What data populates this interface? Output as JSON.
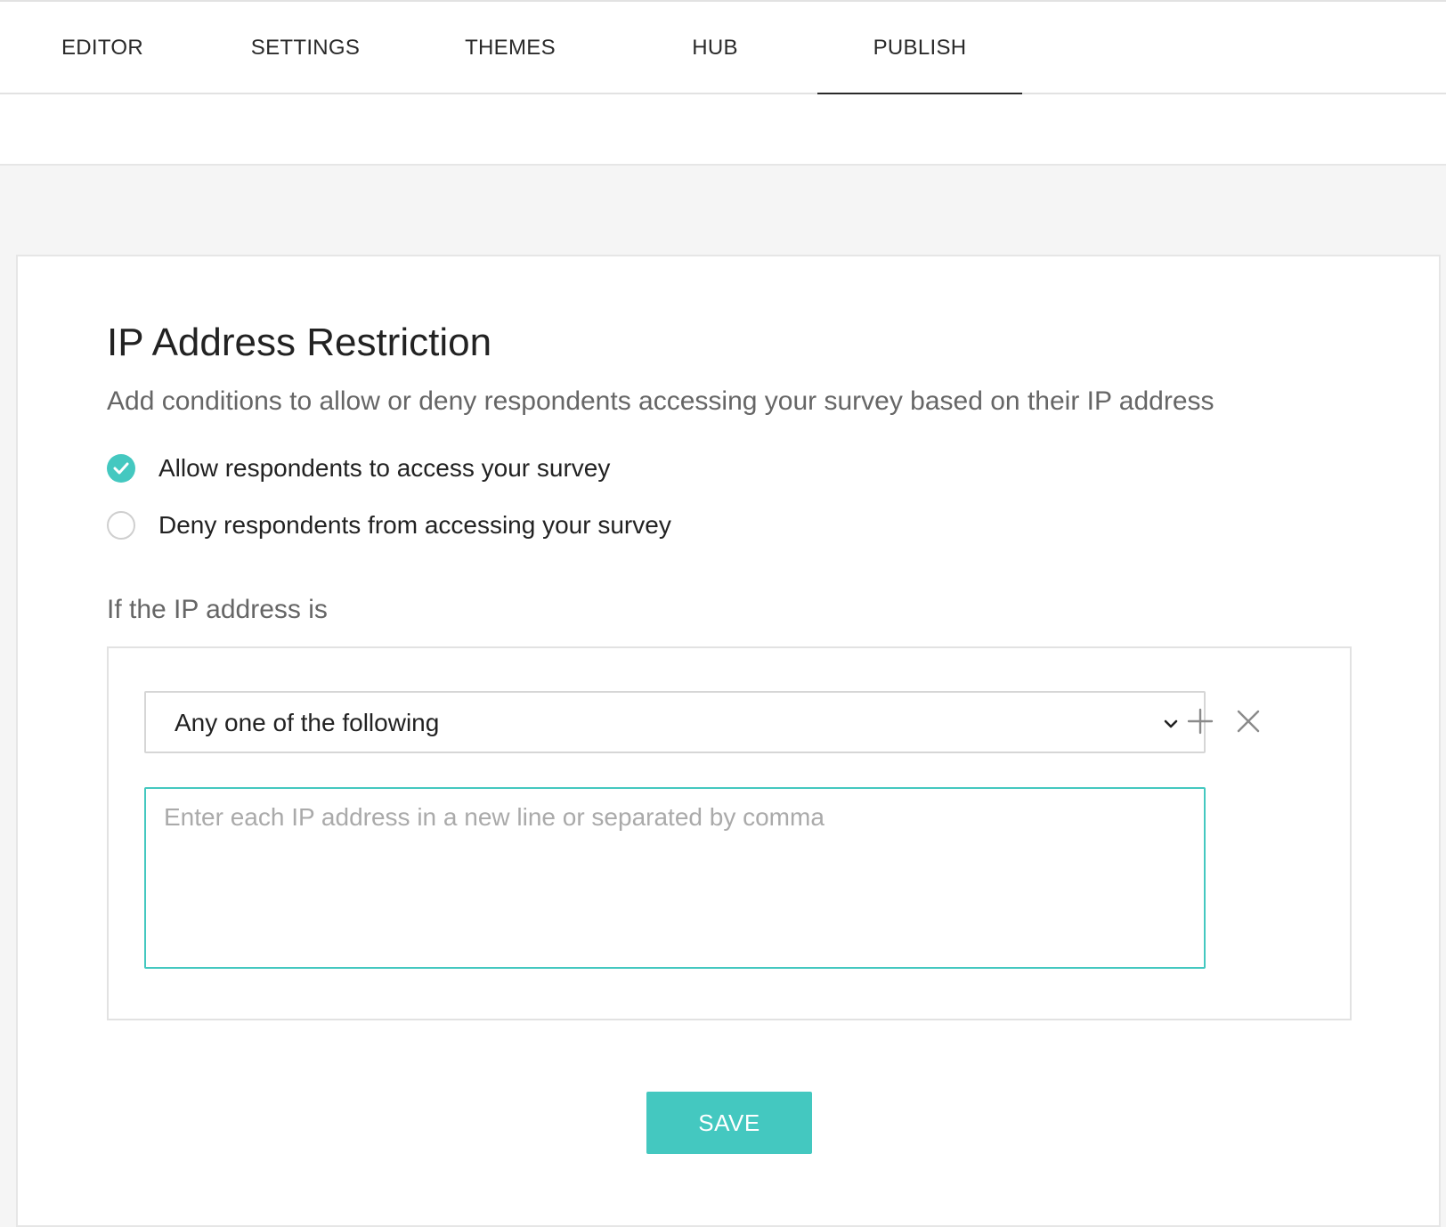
{
  "nav": {
    "tabs": [
      {
        "label": "EDITOR"
      },
      {
        "label": "SETTINGS"
      },
      {
        "label": "THEMES"
      },
      {
        "label": "HUB"
      },
      {
        "label": "PUBLISH",
        "active": true
      }
    ]
  },
  "section": {
    "title": "IP Address Restriction",
    "subtitle": "Add conditions to allow or deny respondents accessing your survey based on their IP address"
  },
  "access_options": [
    {
      "label": "Allow respondents to access your survey",
      "selected": true
    },
    {
      "label": "Deny respondents from accessing your survey",
      "selected": false
    }
  ],
  "condition": {
    "label": "If the IP address is",
    "match_type": "Any one of the following",
    "ip_input": {
      "value": "",
      "placeholder": "Enter each IP address in a new line or separated by comma"
    },
    "icons": {
      "add": "plus-icon",
      "remove": "close-icon",
      "dropdown": "chevron-down-icon"
    }
  },
  "actions": {
    "save_label": "SAVE"
  },
  "colors": {
    "accent": "#44c8c0",
    "page_background": "#f5f5f5",
    "text_primary": "#222222",
    "text_secondary": "#666666"
  }
}
